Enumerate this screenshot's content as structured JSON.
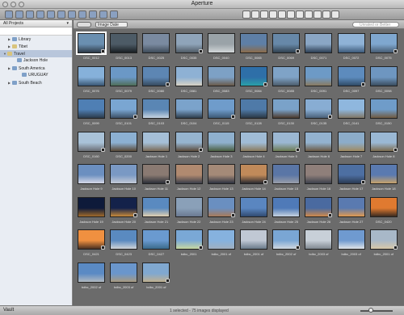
{
  "window": {
    "title": "Aperture"
  },
  "toolbar": {
    "icons": [
      "new-project-icon",
      "import-icon",
      "library-icon",
      "folder-icon",
      "album-icon",
      "smart-album-icon",
      "book-icon",
      "web-icon",
      "stack-icon",
      "rotate-icon",
      "email-icon",
      "pointer-icon",
      "select-icon",
      "crop-icon",
      "straighten-icon",
      "redeye-icon",
      "spot-icon",
      "lift-icon",
      "stamp-icon",
      "loupe-icon",
      "fullscreen-icon",
      "viewer-icon"
    ]
  },
  "sidebar": {
    "header": "All Projects",
    "tree": [
      {
        "label": "Library",
        "indent": 1,
        "type": "library"
      },
      {
        "label": "Tibet",
        "indent": 1,
        "type": "project"
      },
      {
        "label": "Travel",
        "indent": 0,
        "type": "project",
        "selected": true
      },
      {
        "label": "Jackson Hole",
        "indent": 2,
        "type": "folder"
      },
      {
        "label": "South America",
        "indent": 1,
        "type": "folder"
      },
      {
        "label": "URUGUAY",
        "indent": 3,
        "type": "folder"
      },
      {
        "label": "South Beach",
        "indent": 1,
        "type": "folder"
      }
    ]
  },
  "browser": {
    "sort_label": "Image Date",
    "search_placeholder": "Unrated or Better"
  },
  "thumbnails": [
    {
      "cap": "DSC_0012",
      "c1": "#6a8fb0",
      "c2": "#2d3a48"
    },
    {
      "cap": "DSC_0013",
      "c1": "#4d5b66",
      "c2": "#1a1f23"
    },
    {
      "cap": "DSC_0025",
      "c1": "#7a8aa0",
      "c2": "#3e4b58"
    },
    {
      "cap": "DSC_0035",
      "c1": "#8fa4b9",
      "c2": "#4f5a64"
    },
    {
      "cap": "DSC_0040",
      "c1": "#9aa3a8",
      "c2": "#d2d6d8"
    },
    {
      "cap": "DSC_0065",
      "c1": "#5e7fa6",
      "c2": "#8b6b4a"
    },
    {
      "cap": "DSC_0069",
      "c1": "#6788a8",
      "c2": "#31414f"
    },
    {
      "cap": "DSC_0071",
      "c1": "#8aa6c4",
      "c2": "#2c3e52"
    },
    {
      "cap": "DSC_0072",
      "c1": "#8fb2d6",
      "c2": "#3d5a7a"
    },
    {
      "cap": "DSC_0075",
      "c1": "#7fa7cf",
      "c2": "#475c73"
    },
    {
      "cap": "DSC_0076",
      "c1": "#86b1da",
      "c2": "#3a5774"
    },
    {
      "cap": "DSC_0079",
      "c1": "#6b98c6",
      "c2": "#4f6e58"
    },
    {
      "cap": "DSC_0080",
      "c1": "#5d86b3",
      "c2": "#364a5e"
    },
    {
      "cap": "DSC_0081",
      "c1": "#8eb1d4",
      "c2": "#d8d2c4"
    },
    {
      "cap": "DSC_0083",
      "c1": "#7da1c5",
      "c2": "#6a5a4a"
    },
    {
      "cap": "DSC_0084",
      "c1": "#2e6fa8",
      "c2": "#2aa0a8"
    },
    {
      "cap": "DSC_0085",
      "c1": "#7fa3c7",
      "c2": "#4c5c6b"
    },
    {
      "cap": "DSC_0091",
      "c1": "#6d9ac6",
      "c2": "#8a7a60"
    },
    {
      "cap": "DSC_0097",
      "c1": "#5d8bbd",
      "c2": "#2f4a66"
    },
    {
      "cap": "DSC_0098",
      "c1": "#6e96c0",
      "c2": "#3a4c5e"
    },
    {
      "cap": "DSC_0099",
      "c1": "#4f7fb4",
      "c2": "#2b3a4a"
    },
    {
      "cap": "DSC_0101",
      "c1": "#7aa6d2",
      "c2": "#3c5066"
    },
    {
      "cap": "DSC_0103",
      "c1": "#5a86b4",
      "c2": "#c7d4e0"
    },
    {
      "cap": "DSC_0104",
      "c1": "#7ba3cb",
      "c2": "#2e3d4c"
    },
    {
      "cap": "DSC_0115",
      "c1": "#6f9ccb",
      "c2": "#3c5874"
    },
    {
      "cap": "DSC_0128",
      "c1": "#4f7aa8",
      "c2": "#2a3744"
    },
    {
      "cap": "DSC_0130",
      "c1": "#7aa2c9",
      "c2": "#4c3a2c"
    },
    {
      "cap": "DSC_0135",
      "c1": "#88add3",
      "c2": "#4a6078"
    },
    {
      "cap": "DSC_0141",
      "c1": "#8fb7de",
      "c2": "#807664"
    },
    {
      "cap": "DSC_0150",
      "c1": "#6f9cc9",
      "c2": "#705a40"
    },
    {
      "cap": "DSC_0160",
      "c1": "#a9c2d8",
      "c2": "#6a6e74"
    },
    {
      "cap": "DSC_0200",
      "c1": "#8cb0d2",
      "c2": "#5a4a38"
    },
    {
      "cap": "Jackson Hole 1",
      "c1": "#a5bfd7",
      "c2": "#7a6a56"
    },
    {
      "cap": "Jackson Hole 2",
      "c1": "#96b4cf",
      "c2": "#5b4b3b"
    },
    {
      "cap": "Jackson Hole 3",
      "c1": "#8fb0cd",
      "c2": "#4a5f40"
    },
    {
      "cap": "Jackson Hole 4",
      "c1": "#a0bcd6",
      "c2": "#8a7a5c"
    },
    {
      "cap": "Jackson Hole 5",
      "c1": "#9bb7d2",
      "c2": "#6c7a52"
    },
    {
      "cap": "Jackson Hole 6",
      "c1": "#93b2cf",
      "c2": "#6b5a44"
    },
    {
      "cap": "Jackson Hole 7",
      "c1": "#8cacc9",
      "c2": "#a08a60"
    },
    {
      "cap": "Jackson Hole 8",
      "c1": "#9ab8d4",
      "c2": "#7c6c50"
    },
    {
      "cap": "Jackson Hole 9",
      "c1": "#6b8fc0",
      "c2": "#d6d8e6"
    },
    {
      "cap": "Jackson Hole 10",
      "c1": "#7a99c4",
      "c2": "#c4c9d6"
    },
    {
      "cap": "Jackson Hole 11",
      "c1": "#8a7a72",
      "c2": "#2b2f38"
    },
    {
      "cap": "Jackson Hole 12",
      "c1": "#b08a70",
      "c2": "#3a3e4a"
    },
    {
      "cap": "Jackson Hole 13",
      "c1": "#a48a78",
      "c2": "#2c3240"
    },
    {
      "cap": "Jackson Hole 14",
      "c1": "#c08a5a",
      "c2": "#2a2a30"
    },
    {
      "cap": "Jackson Hole 15",
      "c1": "#5a76a6",
      "c2": "#9a9ea8"
    },
    {
      "cap": "Jackson Hole 16",
      "c1": "#8f7f7a",
      "c2": "#3c404c"
    },
    {
      "cap": "Jackson Hole 17",
      "c1": "#4d6fa2",
      "c2": "#2a3a52"
    },
    {
      "cap": "Jackson Hole 18",
      "c1": "#5a7ab0",
      "c2": "#c7a26a"
    },
    {
      "cap": "Jackson Hole 19",
      "c1": "#0e1a3a",
      "c2": "#a06a2a"
    },
    {
      "cap": "Jackson Hole 20",
      "c1": "#14224a",
      "c2": "#c88a3a"
    },
    {
      "cap": "Jackson Hole 21",
      "c1": "#5a8ac0",
      "c2": "#e0d0b0"
    },
    {
      "cap": "Jackson Hole 22",
      "c1": "#8aa0b8",
      "c2": "#6a7890"
    },
    {
      "cap": "Jackson Hole 23",
      "c1": "#6a8fc0",
      "c2": "#a87a5a"
    },
    {
      "cap": "Jackson Hole 24",
      "c1": "#5a86c0",
      "c2": "#304a70"
    },
    {
      "cap": "Jackson Hole 25",
      "c1": "#4f7ab8",
      "c2": "#c6d2e0"
    },
    {
      "cap": "Jackson Hole 26",
      "c1": "#4a6aa0",
      "c2": "#d08a4a"
    },
    {
      "cap": "Jackson Hole 27",
      "c1": "#5a7ab0",
      "c2": "#e09a50"
    },
    {
      "cap": "DSC_0420",
      "c1": "#e07a30",
      "c2": "#3a2a20"
    },
    {
      "cap": "DSC_0421",
      "c1": "#f09040",
      "c2": "#4a3020"
    },
    {
      "cap": "DSC_0423",
      "c1": "#5a8ac0",
      "c2": "#d0d4d8"
    },
    {
      "cap": "DSC_0427",
      "c1": "#6a9ad0",
      "c2": "#3a6a8a"
    },
    {
      "cap": "bdbc_2001",
      "c1": "#7aa8d6",
      "c2": "#c8d8a0"
    },
    {
      "cap": "bdbc_2001 of",
      "c1": "#86b2de",
      "c2": "#a0b0c0"
    },
    {
      "cap": "bdbc_2001 of",
      "c1": "#c0c8d4",
      "c2": "#6a7a8a"
    },
    {
      "cap": "bdbc_2002 of",
      "c1": "#7aa6d4",
      "c2": "#d0d8e0"
    },
    {
      "cap": "bdbc_2003 of",
      "c1": "#c8d0d8",
      "c2": "#808890"
    },
    {
      "cap": "bdbc_2003 of",
      "c1": "#6f9ad0",
      "c2": "#e0e4e8"
    },
    {
      "cap": "bdbc_2001 of",
      "c1": "#a8b8c8",
      "c2": "#d8c8a8"
    },
    {
      "cap": "bdbc_2002 of",
      "c1": "#5a8ac4",
      "c2": "#b0b8c0"
    },
    {
      "cap": "bdbc_2003 of",
      "c1": "#6a96cc",
      "c2": "#a89a80"
    },
    {
      "cap": "bdbc_2001 of",
      "c1": "#80a8d0",
      "c2": "#c0b090"
    }
  ],
  "status": {
    "text": "1 selected - 75 images displayed"
  },
  "bottom": {
    "vault_label": "Vault"
  }
}
